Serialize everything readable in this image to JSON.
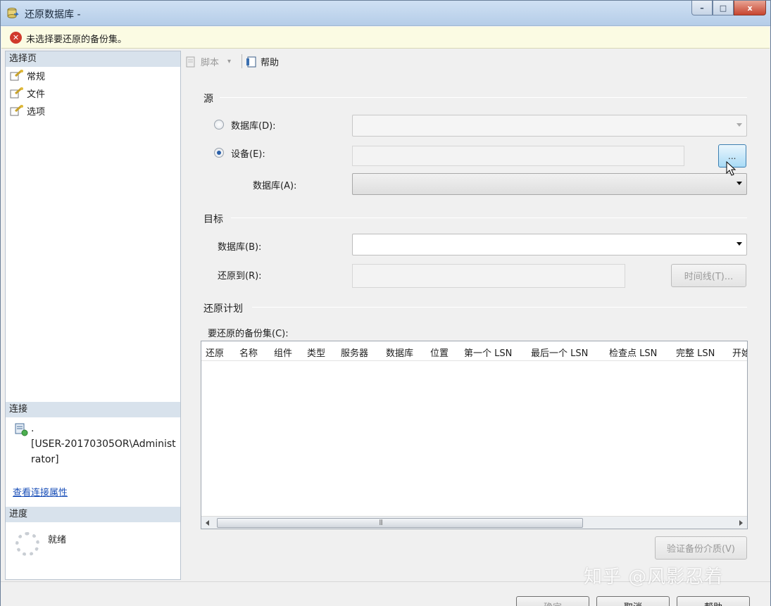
{
  "window": {
    "title": "还原数据库 -",
    "minimize": "–",
    "maximize": "□",
    "close": "x"
  },
  "error_bar": {
    "message": "未选择要还原的备份集。"
  },
  "left_pane": {
    "select_page_header": "选择页",
    "pages": [
      {
        "label": "常规"
      },
      {
        "label": "文件"
      },
      {
        "label": "选项"
      }
    ],
    "connection_header": "连接",
    "connection_server": ".",
    "connection_user": "[USER-20170305OR\\Administrator]",
    "view_connection_properties": "查看连接属性",
    "progress_header": "进度",
    "progress_status": "就绪"
  },
  "toolbar": {
    "script": "脚本",
    "script_dropdown": "▾",
    "help": "帮助"
  },
  "source": {
    "group_label": "源",
    "database_radio": "数据库(D):",
    "device_radio": "设备(E):",
    "browse_button": "...",
    "database_label": "数据库(A):",
    "selected": "device"
  },
  "destination": {
    "group_label": "目标",
    "database_label": "数据库(B):",
    "restore_to_label": "还原到(R):",
    "timeline_button": "时间线(T)..."
  },
  "restore_plan": {
    "group_label": "还原计划",
    "backup_sets_label": "要还原的备份集(C):",
    "columns": [
      "还原",
      "名称",
      "组件",
      "类型",
      "服务器",
      "数据库",
      "位置",
      "第一个 LSN",
      "最后一个 LSN",
      "检查点 LSN",
      "完整 LSN",
      "开始"
    ],
    "grip": "|||",
    "verify_button": "验证备份介质(V)"
  },
  "footer": {
    "ok": "确定",
    "cancel": "取消",
    "help": "帮助"
  },
  "watermark": "知乎 @风影忍着",
  "colors": {
    "error": "#d03a2c",
    "link": "#1a4fb8",
    "section_header": "#d8e2ec",
    "browse_highlight": "#a9dbf6"
  }
}
